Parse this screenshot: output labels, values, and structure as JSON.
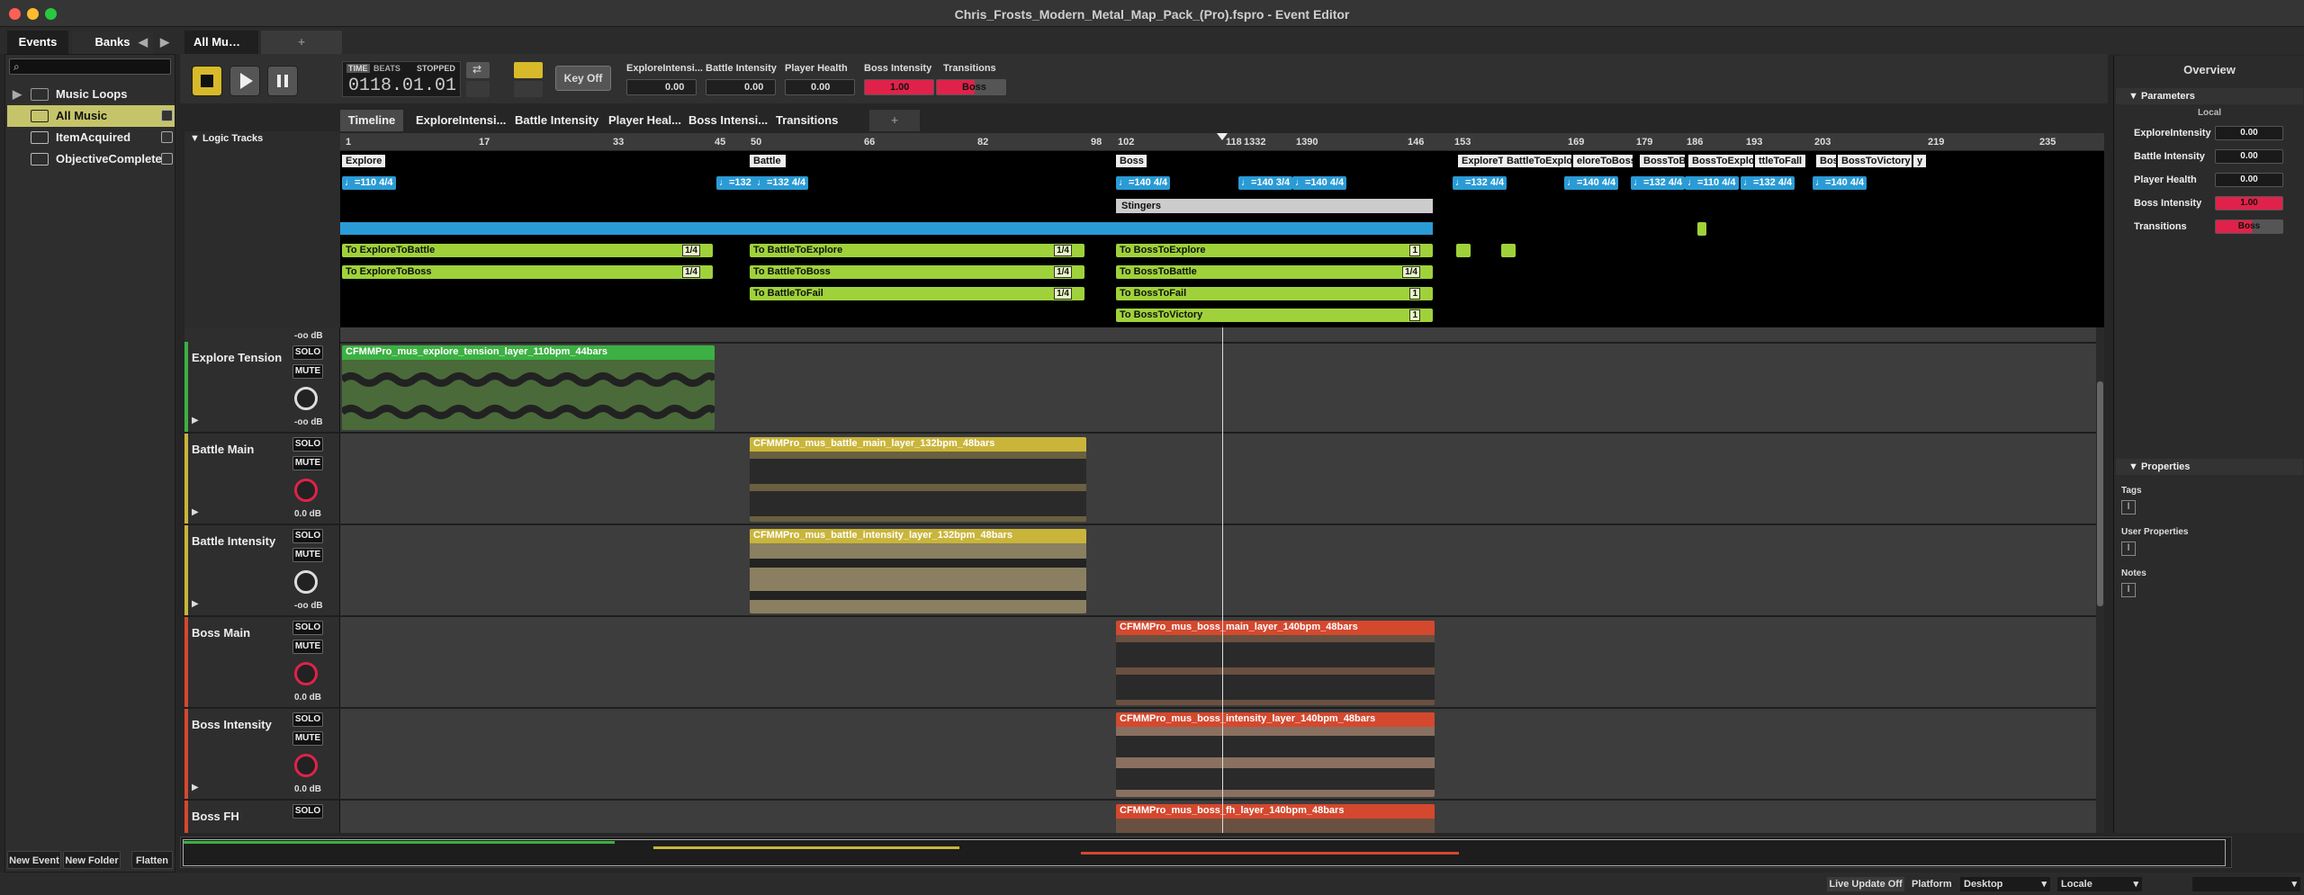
{
  "window": {
    "title": "Chris_Frosts_Modern_Metal_Map_Pack_(Pro).fspro - Event Editor"
  },
  "top_tabs": {
    "events": "Events",
    "banks": "Banks",
    "editor_tab": "All Mu…",
    "add": "+"
  },
  "browser": {
    "items": [
      {
        "label": "Music Loops",
        "type": "folder"
      },
      {
        "label": "All Music",
        "type": "event",
        "selected": true
      },
      {
        "label": "ItemAcquired",
        "type": "event"
      },
      {
        "label": "ObjectiveComplete",
        "type": "event"
      }
    ],
    "buttons": {
      "new_event": "New Event",
      "new_folder": "New Folder",
      "flatten": "Flatten"
    }
  },
  "transport": {
    "time_label": "TIME",
    "beats_label": "BEATS",
    "state": "STOPPED",
    "position": "0118.01.01",
    "key_off": "Key Off",
    "params": [
      {
        "name": "ExploreIntensi...",
        "value": "0.00"
      },
      {
        "name": "Battle Intensity",
        "value": "0.00"
      },
      {
        "name": "Player Health",
        "value": "0.00"
      },
      {
        "name": "Boss Intensity",
        "value": "1.00"
      },
      {
        "name": "Transitions",
        "value": "Boss"
      }
    ]
  },
  "subtabs": [
    "Timeline",
    "ExploreIntensi...",
    "Battle Intensity",
    "Player Heal...",
    "Boss Intensi...",
    "Transitions",
    "+"
  ],
  "logic_tracks_label": "Logic Tracks",
  "ruler": [
    "1",
    "17",
    "33",
    "45",
    "50",
    "66",
    "82",
    "98",
    "102",
    "118",
    "1332",
    "1390",
    "146",
    "153",
    "169",
    "179",
    "186",
    "193",
    "203",
    "219",
    "235"
  ],
  "markers": [
    "Explore",
    "Battle",
    "Boss",
    "ExploreT",
    "BattleToExplore",
    "eloreToBoss",
    "BossToBat",
    "BossToExplore",
    "ttleToFall",
    "Bos",
    "BossToVictory",
    "y"
  ],
  "tempos": [
    "♩=110 4/4",
    "♩=132 4/4",
    "♩=132 4/4",
    "♩=140 4/4",
    "♩=140 3/4",
    "♩=140 4/4",
    "♩=132 4/4",
    "♩=140 4/4",
    "♩=132 4/4",
    "♩=110 4/4",
    "♩=132 4/4",
    "♩=140 4/4"
  ],
  "stingers": "Stingers",
  "transitions": [
    {
      "label": "To ExploreToBattle",
      "q": "1/4"
    },
    {
      "label": "To ExploreToBoss",
      "q": "1/4"
    },
    {
      "label": "To BattleToExplore",
      "q": "1/4"
    },
    {
      "label": "To BattleToBoss",
      "q": "1/4"
    },
    {
      "label": "To BattleToFail",
      "q": "1/4"
    },
    {
      "label": "To BossToExplore",
      "q": "1"
    },
    {
      "label": "To BossToBattle",
      "q": "1/4"
    },
    {
      "label": "To BossToFail",
      "q": "1"
    },
    {
      "label": "To BossToVictory",
      "q": "1"
    }
  ],
  "tracks": [
    {
      "name": "Explore Tension",
      "clip": "CFMMPro_mus_explore_tension_layer_110bpm_44bars",
      "db": "-oo dB",
      "color": "#3cb043"
    },
    {
      "name": "Battle Main",
      "clip": "CFMMPro_mus_battle_main_layer_132bpm_48bars",
      "db": "0.0 dB",
      "color": "#c9b53a"
    },
    {
      "name": "Battle Intensity",
      "clip": "CFMMPro_mus_battle_intensity_layer_132bpm_48bars",
      "db": "-oo dB",
      "color": "#c9b53a"
    },
    {
      "name": "Boss Main",
      "clip": "CFMMPro_mus_boss_main_layer_140bpm_48bars",
      "db": "0.0 dB",
      "color": "#d4482e"
    },
    {
      "name": "Boss Intensity",
      "clip": "CFMMPro_mus_boss_intensity_layer_140bpm_48bars",
      "db": "0.0 dB",
      "color": "#d4482e"
    },
    {
      "name": "Boss FH",
      "clip": "CFMMPro_mus_boss_fh_layer_140bpm_48bars",
      "db": "",
      "color": "#d4482e"
    }
  ],
  "first_track_db": "-oo dB",
  "solo": "SOLO",
  "mute": "MUTE",
  "overview": {
    "title": "Overview",
    "parameters": "Parameters",
    "local": "Local",
    "params": [
      {
        "name": "ExploreIntensity",
        "value": "0.00"
      },
      {
        "name": "Battle Intensity",
        "value": "0.00"
      },
      {
        "name": "Player Health",
        "value": "0.00"
      },
      {
        "name": "Boss Intensity",
        "value": "1.00"
      },
      {
        "name": "Transitions",
        "value": "Boss"
      }
    ],
    "properties": "Properties",
    "tags": "Tags",
    "user_properties": "User Properties",
    "notes": "Notes"
  },
  "status": {
    "live_update": "Live Update Off",
    "platform_label": "Platform",
    "platform": "Desktop",
    "locale": "Locale"
  }
}
